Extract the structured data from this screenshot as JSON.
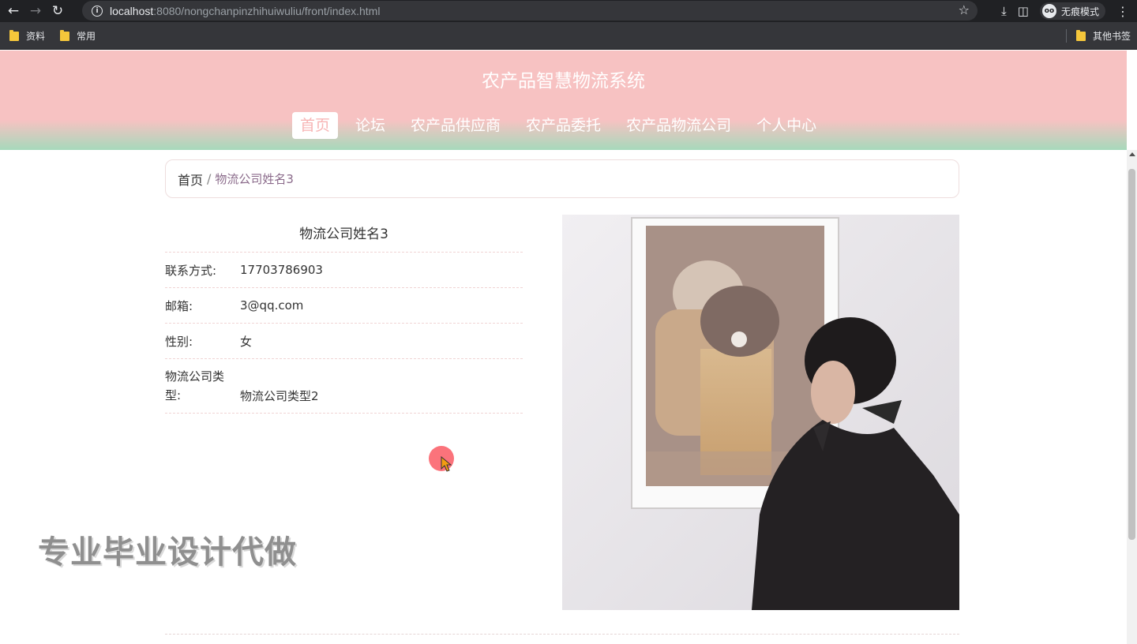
{
  "browser": {
    "url_host": "localhost",
    "url_rest": ":8080/nongchanpinzhihuiwuliu/front/index.html",
    "incognito_label": "无痕模式",
    "bookmarks": [
      "资料",
      "常用"
    ],
    "other_bookmarks": "其他书签"
  },
  "header": {
    "title": "农产品智慧物流系统",
    "nav": [
      {
        "label": "首页",
        "active": true
      },
      {
        "label": "论坛"
      },
      {
        "label": "农产品供应商"
      },
      {
        "label": "农产品委托"
      },
      {
        "label": "农产品物流公司"
      },
      {
        "label": "个人中心"
      }
    ]
  },
  "breadcrumb": {
    "home": "首页",
    "separator": "/",
    "current": "物流公司姓名3"
  },
  "detail": {
    "title": "物流公司姓名3",
    "rows": [
      {
        "label": "联系方式:",
        "value": "17703786903"
      },
      {
        "label": "邮箱:",
        "value": "3@qq.com"
      },
      {
        "label": "性别:",
        "value": "女"
      },
      {
        "label": "物流公司类型:",
        "value": "物流公司类型2"
      }
    ]
  },
  "watermark": "专业毕业设计代做",
  "colors": {
    "header_pink": "#f7c2c2",
    "header_green": "#a6d9bb",
    "active_text": "#f7b4b4"
  }
}
